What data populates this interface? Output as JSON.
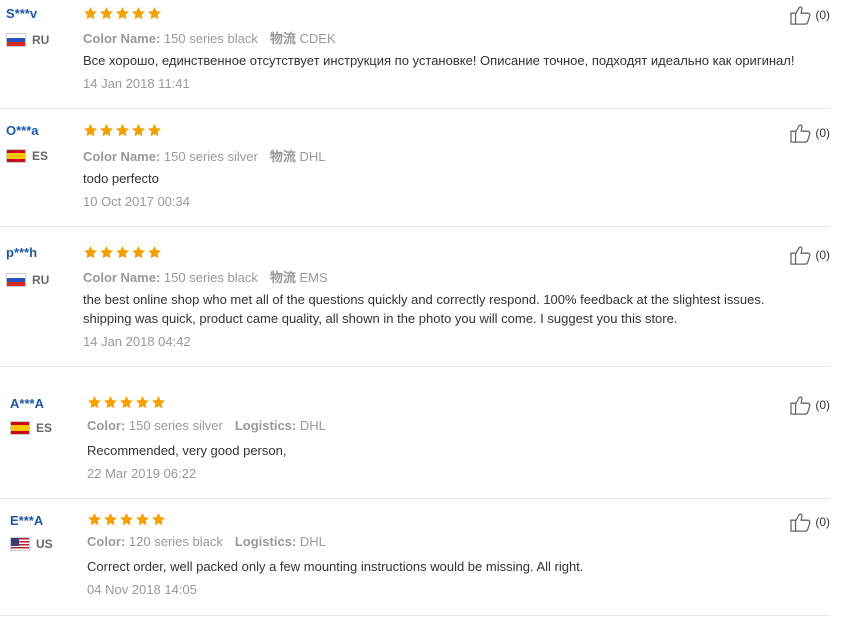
{
  "colors": {
    "username": "#1f57a6",
    "star": "#f59f00",
    "muted": "#999999",
    "divider": "#e6e6e6"
  },
  "reviews": [
    {
      "user": "S***v",
      "country": "RU",
      "flag": "russia-flag",
      "rating": 5,
      "attr1_label": "Color Name:",
      "attr1_value": "150 series black",
      "attr2_label": "物流",
      "attr2_value": "CDEK",
      "lines": [
        "Все хорошо, единственное отсутствует инструкция по установке! Описание точное, подходят идеально как оригинал!"
      ],
      "date": "14 Jan 2018 11:41",
      "likes": "(0)"
    },
    {
      "user": "O***a",
      "country": "ES",
      "flag": "spain-flag",
      "rating": 5,
      "attr1_label": "Color Name:",
      "attr1_value": "150 series silver",
      "attr2_label": "物流",
      "attr2_value": "DHL",
      "lines": [
        "todo perfecto"
      ],
      "date": "10 Oct 2017 00:34",
      "likes": "(0)"
    },
    {
      "user": "p***h",
      "country": "RU",
      "flag": "russia-flag",
      "rating": 5,
      "attr1_label": "Color Name:",
      "attr1_value": "150 series black",
      "attr2_label": "物流",
      "attr2_value": "EMS",
      "lines": [
        "the best online shop who met all of the questions quickly and correctly respond. 100% feedback at the slightest issues.",
        "shipping was quick, product came quality, all shown in the photo you will come. I suggest you this store."
      ],
      "date": "14 Jan 2018 04:42",
      "likes": "(0)"
    },
    {
      "user": "A***A",
      "country": "ES",
      "flag": "spain-flag",
      "rating": 5,
      "attr1_label": "Color:",
      "attr1_value": "150 series silver",
      "attr2_label": "Logistics:",
      "attr2_value": "DHL",
      "lines": [
        "Recommended, very good person,"
      ],
      "date": "22 Mar 2019 06:22",
      "likes": "(0)"
    },
    {
      "user": "E***A",
      "country": "US",
      "flag": "usa-flag",
      "rating": 5,
      "attr1_label": "Color:",
      "attr1_value": "120 series black",
      "attr2_label": "Logistics:",
      "attr2_value": "DHL",
      "lines": [
        "Correct order, well packed only a few mounting instructions would be missing. All right."
      ],
      "date": "04 Nov 2018 14:05",
      "likes": "(0)"
    }
  ]
}
